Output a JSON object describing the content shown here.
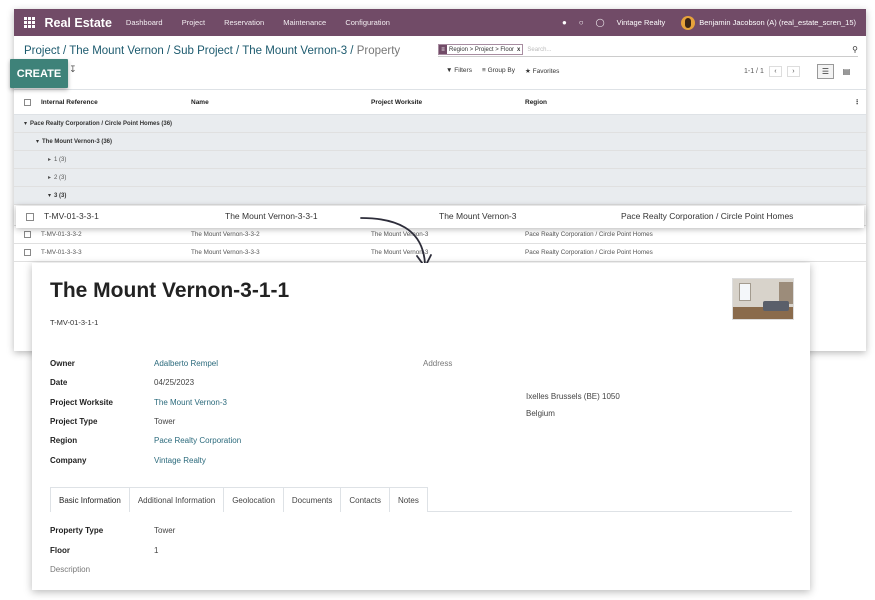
{
  "navbar": {
    "app_name": "Real Estate",
    "menu": [
      "Dashboard",
      "Project",
      "Reservation",
      "Maintenance",
      "Configuration"
    ],
    "company": "Vintage Realty",
    "user": "Benjamin Jacobson (A) (real_estate_scren_15)"
  },
  "breadcrumb": {
    "links": [
      "Project",
      "The Mount Vernon",
      "Sub Project",
      "The Mount Vernon-3"
    ],
    "separator": " / ",
    "current": "Property"
  },
  "search": {
    "facet": "Region > Project > Floor",
    "facet_close": "x",
    "placeholder": "Search..."
  },
  "toolbar": {
    "create_label": "CREATE",
    "filters_label": "Filters",
    "groupby_label": "Group By",
    "favorites_label": "Favorites",
    "pager": "1-1 / 1"
  },
  "list": {
    "columns": [
      "Internal Reference",
      "Name",
      "Project Worksite",
      "Region"
    ],
    "groups": [
      {
        "label": "Pace Realty Corporation / Circle Point Homes (36)",
        "level": 0,
        "caret": "▾"
      },
      {
        "label": "The Mount Vernon-3 (36)",
        "level": 1,
        "caret": "▾"
      },
      {
        "label": "1 (3)",
        "level": 2,
        "caret": "▸"
      },
      {
        "label": "2 (3)",
        "level": 2,
        "caret": "▸"
      },
      {
        "label": "3 (3)",
        "level": 2,
        "caret": "▾"
      }
    ],
    "highlight_row": {
      "ref": "T-MV-01-3-3-1",
      "name": "The Mount Vernon-3-3-1",
      "worksite": "The Mount Vernon-3",
      "region": "Pace Realty Corporation / Circle Point Homes"
    },
    "rows": [
      {
        "ref": "T-MV-01-3-3-2",
        "name": "The Mount Vernon-3-3-2",
        "worksite": "The Mount Vernon-3",
        "region": "Pace Realty Corporation / Circle Point Homes"
      },
      {
        "ref": "T-MV-01-3-3-3",
        "name": "The Mount Vernon-3-3-3",
        "worksite": "The Mount Vernon-3",
        "region": "Pace Realty Corporation / Circle Point Homes"
      }
    ]
  },
  "form": {
    "title": "The Mount Vernon-3-1-1",
    "reference": "T-MV-01-3-1-1",
    "fields": {
      "owner_label": "Owner",
      "owner": "Adalberto Rempel",
      "date_label": "Date",
      "date": "04/25/2023",
      "worksite_label": "Project Worksite",
      "worksite": "The Mount Vernon-3",
      "type_label": "Project Type",
      "type": "Tower",
      "region_label": "Region",
      "region": "Pace Realty Corporation",
      "company_label": "Company",
      "company": "Vintage Realty"
    },
    "address_label": "Address",
    "address_line1": "Ixelles  Brussels (BE)  1050",
    "address_line2": "Belgium",
    "tabs": [
      "Basic Information",
      "Additional Information",
      "Geolocation",
      "Documents",
      "Contacts",
      "Notes"
    ],
    "tab_fields": {
      "property_type_label": "Property Type",
      "property_type": "Tower",
      "floor_label": "Floor",
      "floor": "1",
      "description_label": "Description"
    }
  },
  "colors": {
    "navbar": "#714b67",
    "create_button": "#3e8279",
    "link": "#2b6a7c",
    "group_bg": "#e9ecef"
  }
}
